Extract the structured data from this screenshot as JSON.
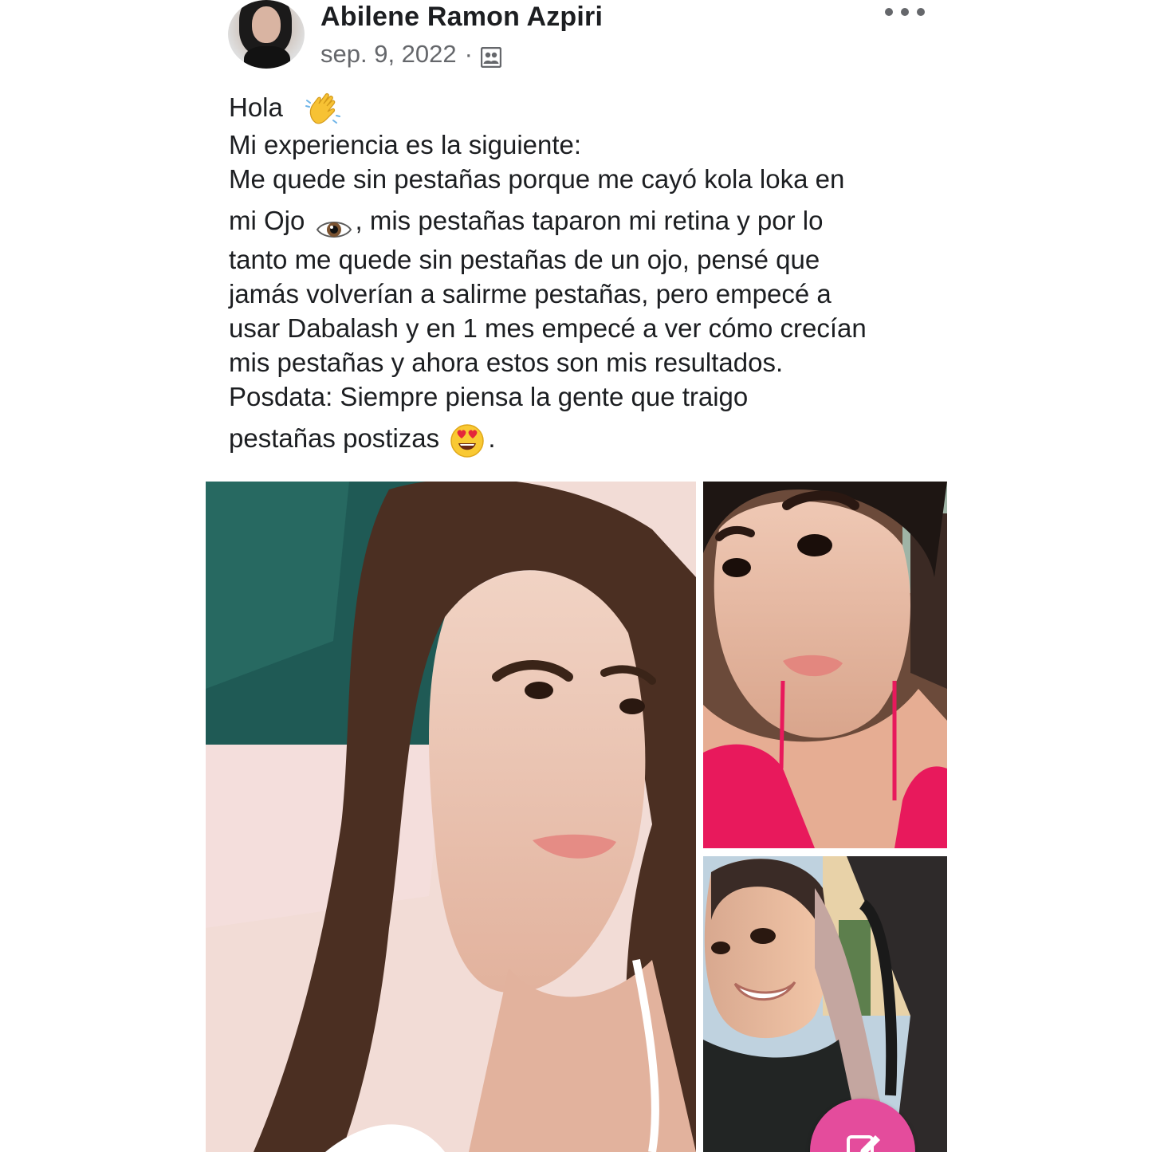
{
  "post": {
    "author": "Abilene Ramon Azpiri",
    "date": "sep. 9, 2022",
    "separator": "·",
    "lines": [
      "Hola",
      "Mi experiencia es la siguiente:",
      "Me quede sin pestañas porque me cayó kola loka en",
      "mi Ojo",
      ", mis pestañas taparon mi retina y por lo",
      "tanto me quede sin pestañas de un ojo, pensé que",
      "jamás volverían a salirme pestañas, pero  empecé a",
      "usar Dabalash y en 1 mes empecé a ver cómo crecían",
      "mis pestañas y ahora estos son mis resultados.",
      "Posdata: Siempre piensa la gente que traigo",
      "pestañas postizas",
      "."
    ]
  },
  "icons": {
    "audience": "friends-audience-icon",
    "more": "more-options-icon",
    "wave": "waving-hand-emoji",
    "eye": "eye-emoji",
    "heart_eyes": "heart-eyes-emoji",
    "compose": "compose-edit-icon"
  },
  "colors": {
    "text": "#1c1e21",
    "meta": "#65676b",
    "compose_button": "#e44c9c"
  }
}
